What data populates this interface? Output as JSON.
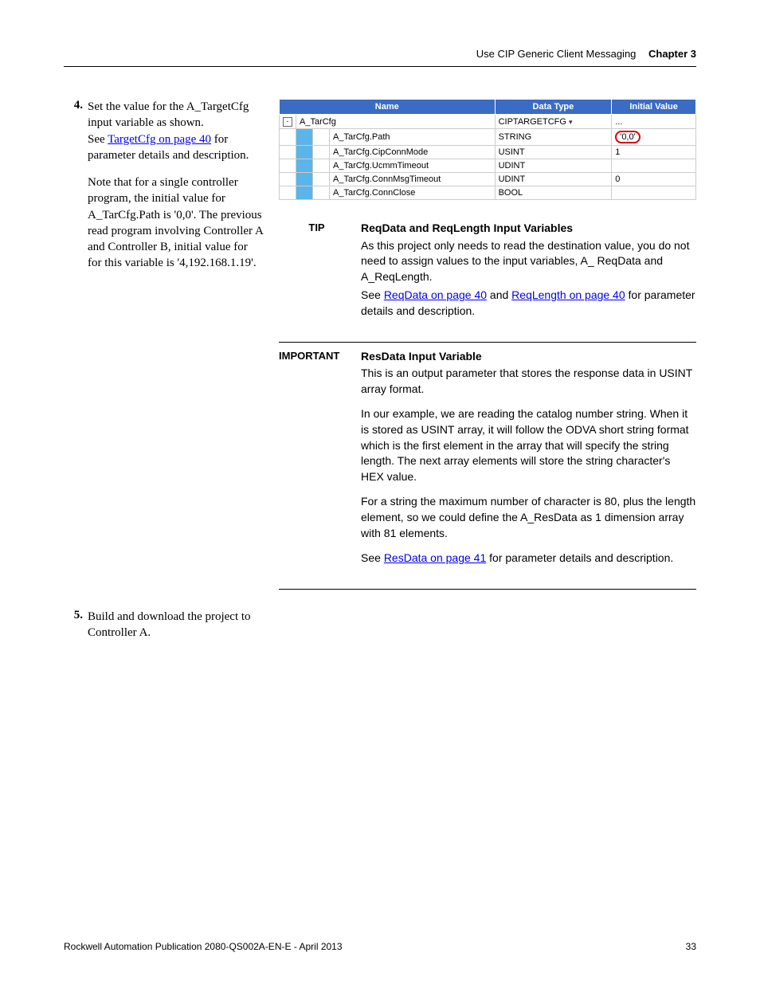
{
  "header": {
    "title": "Use CIP Generic Client Messaging",
    "chapter": "Chapter 3"
  },
  "steps": {
    "s4": {
      "num": "4.",
      "p1a": "Set the value for the A_TargetCfg  input variable as shown.",
      "p1b_pre": "See ",
      "p1b_link": "TargetCfg on page 40",
      "p1b_post": " for parameter details and description.",
      "p2": "Note that for a single controller program, the initial value for A_TarCfg.Path is '0,0'.  The previous read program involving Controller A and Controller B, initial value for for this variable is  '4,192.168.1.19'."
    },
    "s5": {
      "num": "5.",
      "p1": "Build and download the project to Controller A."
    }
  },
  "var_table": {
    "headers": {
      "name": "Name",
      "datatype": "Data Type",
      "initval": "Initial Value"
    },
    "root": {
      "name": "A_TarCfg",
      "datatype": "CIPTARGETCFG",
      "initval": "..."
    },
    "rows": [
      {
        "name": "A_TarCfg.Path",
        "datatype": "STRING",
        "initval": "'0,0'",
        "highlight": true
      },
      {
        "name": "A_TarCfg.CipConnMode",
        "datatype": "USINT",
        "initval": "1"
      },
      {
        "name": "A_TarCfg.UcmmTimeout",
        "datatype": "UDINT",
        "initval": ""
      },
      {
        "name": "A_TarCfg.ConnMsgTimeout",
        "datatype": "UDINT",
        "initval": "0"
      },
      {
        "name": "A_TarCfg.ConnClose",
        "datatype": "BOOL",
        "initval": ""
      }
    ]
  },
  "tip": {
    "label": "TIP",
    "title": "ReqData and ReqLength Input Variables",
    "p1": "As this project only needs to read the destination value, you do not need to assign values to the input variables, A_ ReqData and A_ReqLength.",
    "p2_pre": "See ",
    "p2_link1": "ReqData on page 40",
    "p2_mid": " and ",
    "p2_link2": "ReqLength on page 40",
    "p2_post": " for parameter details and description."
  },
  "important": {
    "label": "IMPORTANT",
    "title": "ResData Input Variable",
    "p1": "This is an output parameter that stores the response data in USINT array format.",
    "p2": "In our example, we are reading the catalog number string. When it is stored as USINT array, it will follow the ODVA short string format which is the first element in the array that will specify the string length. The next array elements will store the string character's HEX value.",
    "p3": "For a string the maximum number of character is 80, plus the length element, so we could define the A_ResData as 1 dimension array with 81 elements.",
    "p4_pre": "See ",
    "p4_link": "ResData on page 41",
    "p4_post": " for parameter details and description."
  },
  "footer": {
    "pub": "Rockwell Automation Publication 2080-QS002A-EN-E - April 2013",
    "page": "33"
  }
}
